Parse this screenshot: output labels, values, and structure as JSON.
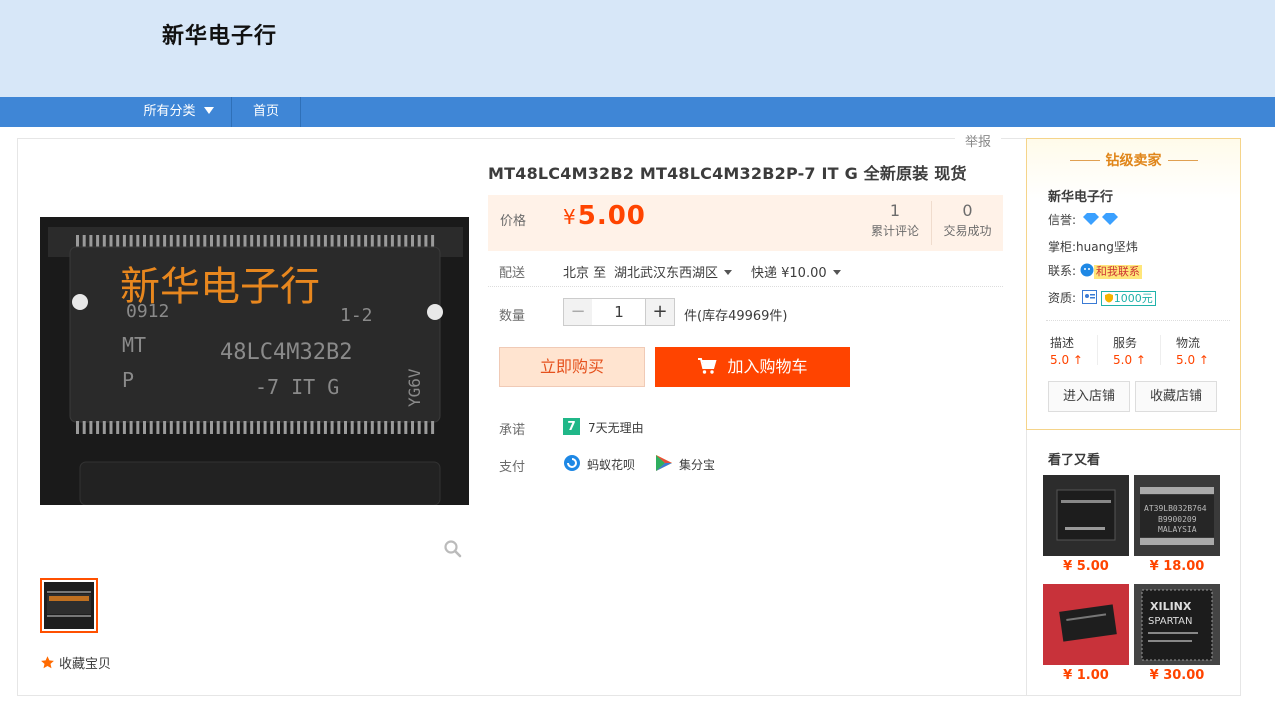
{
  "header": {
    "shop_name": "新华电子行"
  },
  "nav": {
    "all_categories": "所有分类",
    "home": "首页"
  },
  "report_label": "举报",
  "product": {
    "title": "MT48LC4M32B2 MT48LC4M32B2P-7 IT G 全新原装 现货",
    "image_watermark": "新华电子行",
    "chip_lines": [
      "0912",
      "1-2",
      "MT",
      "48LC4M32B2",
      "P",
      "-7 IT G",
      "YG6V"
    ],
    "favorite_label": "收藏宝贝"
  },
  "price": {
    "label": "价格",
    "currency": "¥",
    "value": "5.00"
  },
  "stats": [
    {
      "value": "1",
      "label": "累计评论"
    },
    {
      "value": "0",
      "label": "交易成功"
    }
  ],
  "shipping": {
    "label": "配送",
    "from": "北京 至",
    "to": "湖北武汉东西湖区",
    "method": "快递 ¥10.00"
  },
  "quantity": {
    "label": "数量",
    "value": "1",
    "minus": "−",
    "plus": "+",
    "stock": "件(库存49969件)"
  },
  "buttons": {
    "buy_now": "立即购买",
    "add_to_cart": "加入购物车"
  },
  "promise": {
    "label": "承诺",
    "icon_text": "7",
    "text": "7天无理由"
  },
  "payment": {
    "label": "支付",
    "methods": [
      "蚂蚁花呗",
      "集分宝"
    ]
  },
  "seller": {
    "level_title": "钻级卖家",
    "name": "新华电子行",
    "reputation_label": "信誉:",
    "keeper_label": "掌柜:",
    "keeper_name": "huang坚炜",
    "contact_label": "联系:",
    "contact_button": "和我联系",
    "qualification_label": "资质:",
    "deposit": "1000元",
    "scores": [
      {
        "label": "描述",
        "value": "5.0"
      },
      {
        "label": "服务",
        "value": "5.0"
      },
      {
        "label": "物流",
        "value": "5.0"
      }
    ],
    "enter_shop": "进入店铺",
    "favorite_shop": "收藏店铺"
  },
  "recommend": {
    "title": "看了又看",
    "items": [
      {
        "price": "¥ 5.00"
      },
      {
        "price": "¥ 18.00",
        "chip_text": [
          "AT39LB032B764",
          "B9900209",
          "MALAYSIA"
        ]
      },
      {
        "price": "¥ 1.00"
      },
      {
        "price": "¥ 30.00",
        "chip_text": [
          "XILINX",
          "SPARTAN"
        ]
      }
    ]
  },
  "colors": {
    "accent": "#ff4400",
    "nav": "#3f86d6",
    "header_bg": "#d7e7f8"
  }
}
